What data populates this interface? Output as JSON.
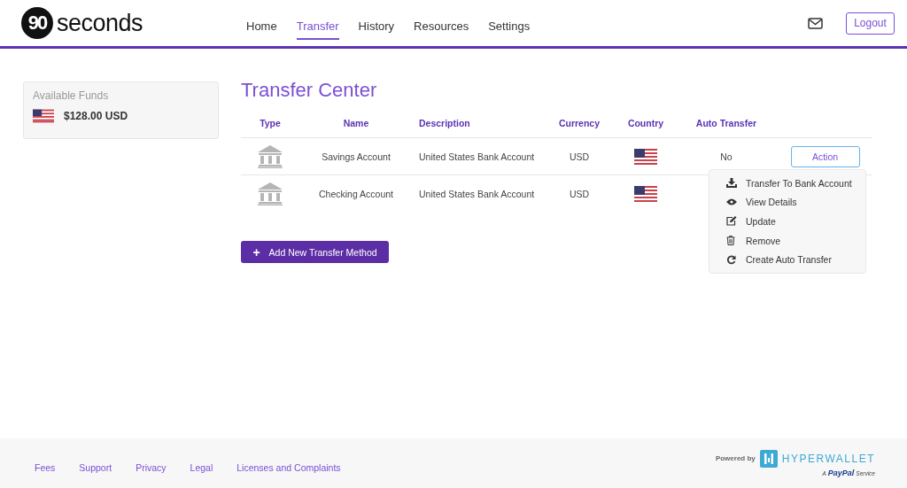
{
  "brand": {
    "mark": "90",
    "name": "seconds"
  },
  "nav": [
    {
      "label": "Home",
      "selected": false
    },
    {
      "label": "Transfer",
      "selected": true
    },
    {
      "label": "History",
      "selected": false
    },
    {
      "label": "Resources",
      "selected": false
    },
    {
      "label": "Settings",
      "selected": false
    }
  ],
  "logout": "Logout",
  "funds": {
    "title": "Available Funds",
    "amount": "$128.00 USD"
  },
  "title": "Transfer Center",
  "table": {
    "columns": [
      "Type",
      "Name",
      "Description",
      "Currency",
      "Country",
      "Auto Transfer"
    ],
    "rows": [
      {
        "name": "Savings Account",
        "description": "United States Bank Account",
        "currency": "USD",
        "auto_transfer": "No",
        "action": "Action"
      },
      {
        "name": "Checking Account",
        "description": "United States Bank Account",
        "currency": "USD"
      }
    ]
  },
  "menu": [
    {
      "kind": "download",
      "label": "Transfer To Bank Account"
    },
    {
      "kind": "view",
      "label": "View Details"
    },
    {
      "kind": "edit",
      "label": "Update"
    },
    {
      "kind": "remove",
      "label": "Remove"
    },
    {
      "kind": "refresh",
      "label": "Create Auto Transfer"
    }
  ],
  "add_button": {
    "icon": "+",
    "label": "Add New Transfer Method"
  },
  "footer": {
    "links": [
      "Fees",
      "Support",
      "Privacy",
      "Legal",
      "Licenses and Complaints"
    ],
    "powered_by": "Powered by",
    "provider": "HYPERWALLET",
    "tagline_a": "A",
    "tagline_brand": "PayPal",
    "tagline_service": "Service"
  }
}
